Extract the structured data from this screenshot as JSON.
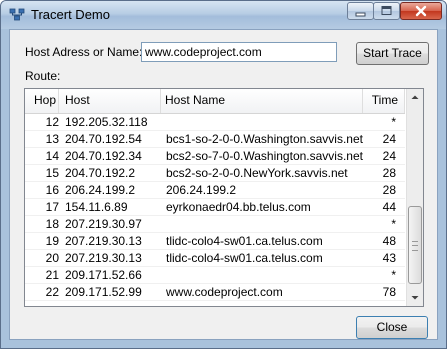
{
  "window": {
    "title": "Tracert Demo"
  },
  "form": {
    "host_label": "Host Adress or Name:",
    "host_value": "www.codeproject.com",
    "start_button": "Start Trace",
    "route_label": "Route:",
    "close_button": "Close"
  },
  "table": {
    "columns": [
      "Hop",
      "Host",
      "Host Name",
      "Time"
    ],
    "rows": [
      {
        "hop": "12",
        "host": "192.205.32.118",
        "name": "",
        "time": "*"
      },
      {
        "hop": "13",
        "host": "204.70.192.54",
        "name": "bcs1-so-2-0-0.Washington.savvis.net",
        "time": "24"
      },
      {
        "hop": "14",
        "host": "204.70.192.34",
        "name": "bcs2-so-7-0-0.Washington.savvis.net",
        "time": "24"
      },
      {
        "hop": "15",
        "host": "204.70.192.2",
        "name": "bcs2-so-2-0-0.NewYork.savvis.net",
        "time": "28"
      },
      {
        "hop": "16",
        "host": "206.24.199.2",
        "name": "206.24.199.2",
        "time": "28"
      },
      {
        "hop": "17",
        "host": "154.11.6.89",
        "name": "eyrkonaedr04.bb.telus.com",
        "time": "44"
      },
      {
        "hop": "18",
        "host": "207.219.30.97",
        "name": "",
        "time": "*"
      },
      {
        "hop": "19",
        "host": "207.219.30.13",
        "name": "tlidc-colo4-sw01.ca.telus.com",
        "time": "48"
      },
      {
        "hop": "20",
        "host": "207.219.30.13",
        "name": "tlidc-colo4-sw01.ca.telus.com",
        "time": "43"
      },
      {
        "hop": "21",
        "host": "209.171.52.66",
        "name": "",
        "time": "*"
      },
      {
        "hop": "22",
        "host": "209.171.52.99",
        "name": "www.codeproject.com",
        "time": "78"
      }
    ]
  },
  "icons": {
    "app": "network-icon",
    "minimize": "minimize-icon",
    "maximize": "maximize-icon",
    "close": "close-icon",
    "scroll_up": "scroll-up-icon",
    "scroll_down": "scroll-down-icon"
  }
}
